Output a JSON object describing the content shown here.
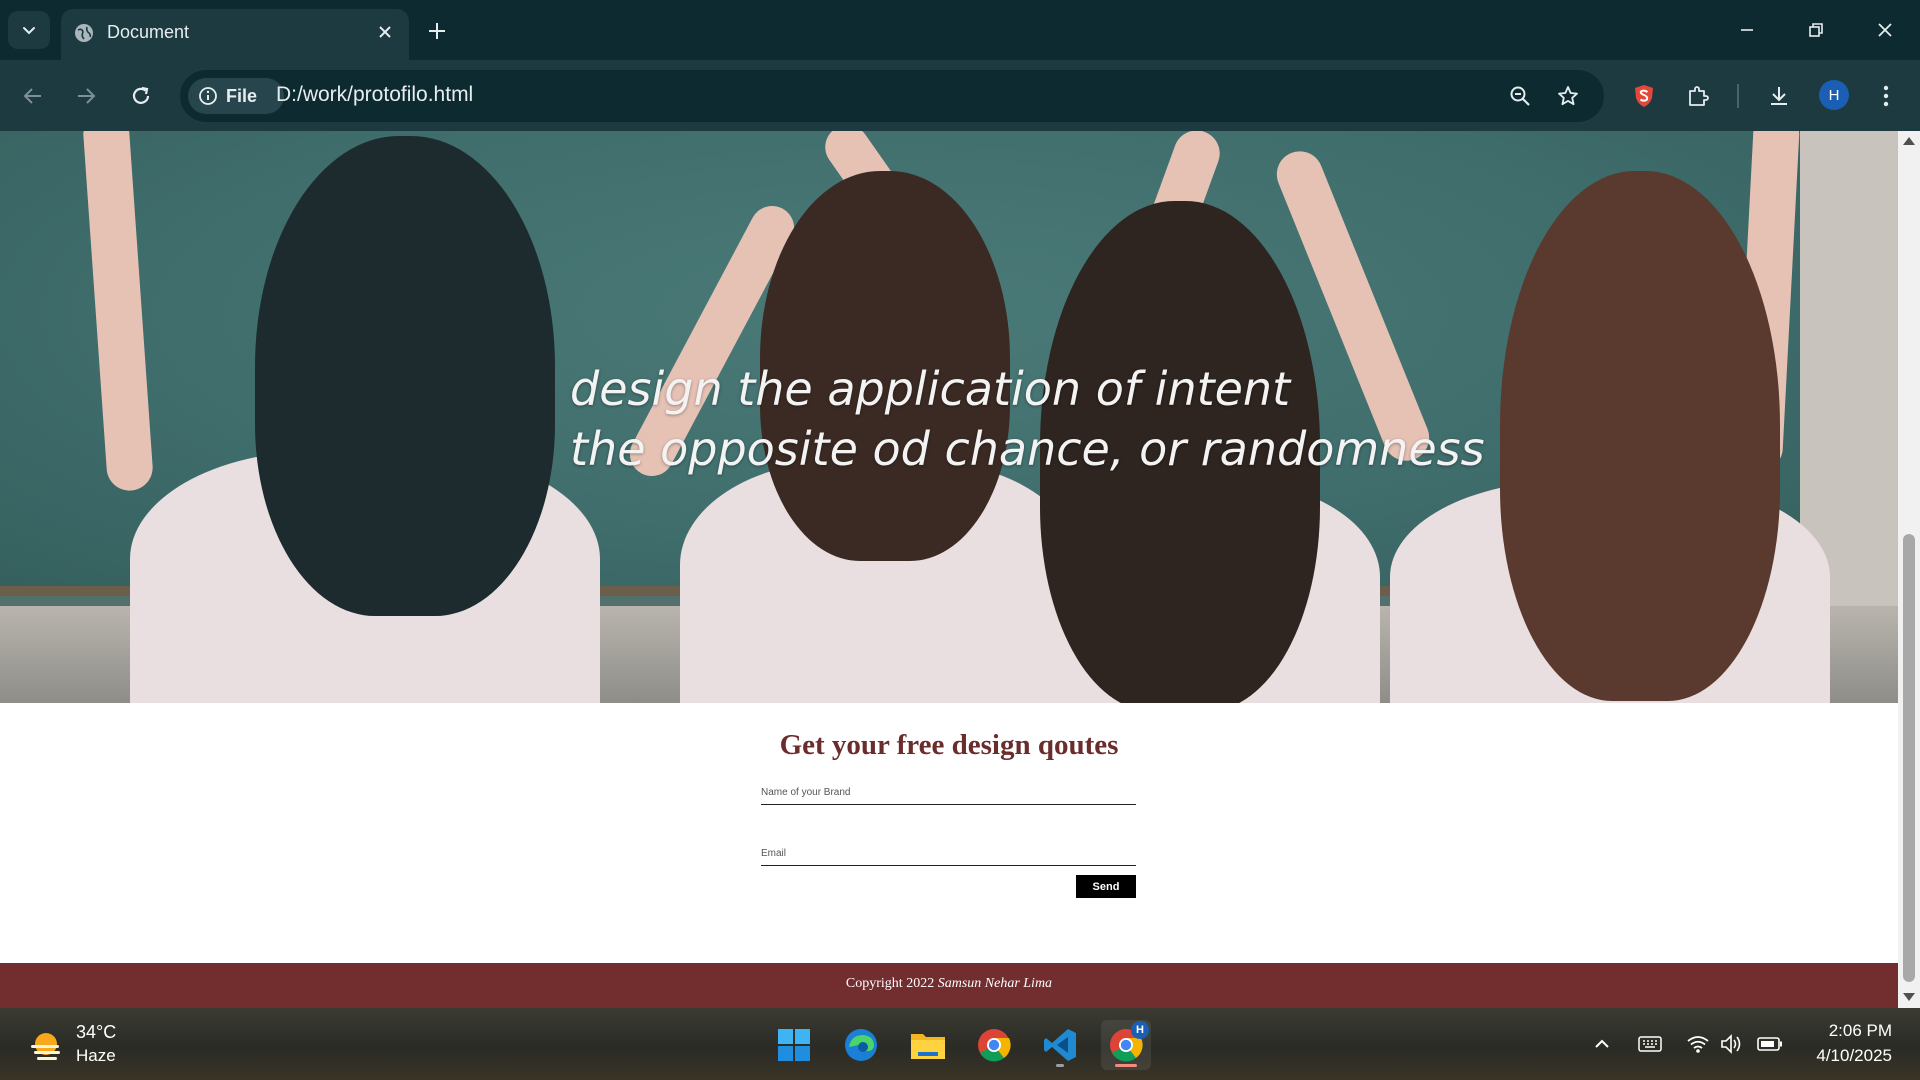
{
  "browser": {
    "tab_title": "Document",
    "site_chip_label": "File",
    "url": "D:/work/protofilo.html",
    "profile_initial": "H"
  },
  "page": {
    "hero_line1": "design the application of intent",
    "hero_line2": "the opposite od chance, or randomness",
    "quote_title": "Get your free design qoutes",
    "brand_placeholder": "Name of your Brand",
    "email_placeholder": "Email",
    "send_label": "Send",
    "footer_prefix": "Copyright 2022 ",
    "footer_name": "Samsun Nehar Lima"
  },
  "taskbar": {
    "temperature": "34°C",
    "condition": "Haze",
    "time": "2:06 PM",
    "date": "4/10/2025",
    "chrome_badge": "H",
    "apps": [
      "start-menu",
      "edge",
      "file-explorer",
      "chrome",
      "vscode",
      "chrome-profile"
    ]
  },
  "colors": {
    "chrome_dark": "#0e2a31",
    "chrome_toolbar": "#1d3a41",
    "title_maroon": "#6b2c2c",
    "footer_maroon": "#722d2f",
    "send_button": "#000000"
  }
}
